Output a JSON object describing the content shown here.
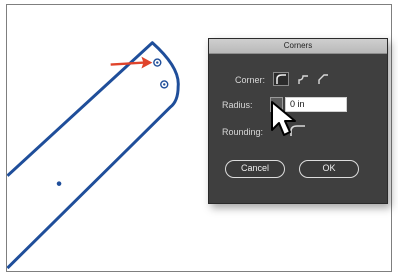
{
  "dialog": {
    "title": "Corners",
    "corner_label": "Corner:",
    "radius_label": "Radius:",
    "radius_value": "0 in",
    "rounding_label": "Rounding:",
    "cancel_label": "Cancel",
    "ok_label": "OK"
  },
  "colors": {
    "shape_stroke": "#1f4e9a",
    "arrow": "#e0442b",
    "dialog_bg": "#3f3f3f"
  }
}
